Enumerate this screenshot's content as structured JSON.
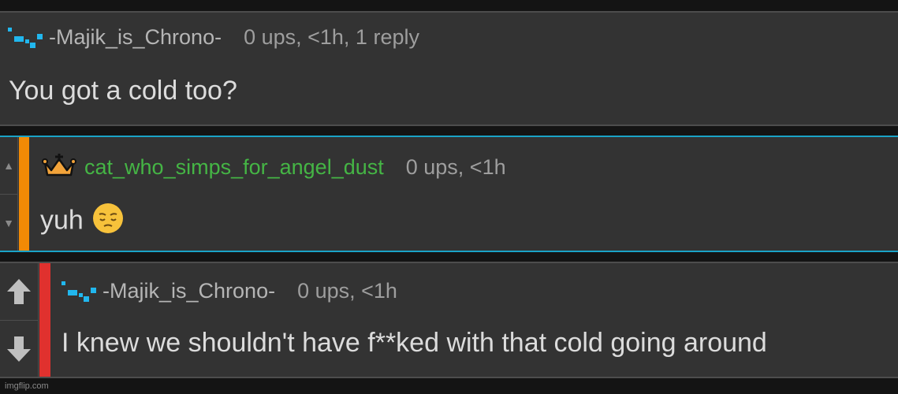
{
  "comments": [
    {
      "username": "-Majik_is_Chrono-",
      "meta": "0 ups, <1h, 1 reply",
      "text": "You got a cold too?"
    },
    {
      "username": "cat_who_simps_for_angel_dust",
      "meta": "0 ups, <1h",
      "text": "yuh",
      "username_color": "#45b545",
      "bar_color": "#f28a05"
    },
    {
      "username": "-Majik_is_Chrono-",
      "meta": "0 ups, <1h",
      "text": "I knew we shouldn't have f**ked with that cold going around",
      "bar_color": "#e0312e"
    }
  ],
  "icons": {
    "badge": "pixel-badge-icon",
    "crown": "crown-icon",
    "emoji": "pensive-face-emoji",
    "upvote": "arrow-up-icon",
    "downvote": "arrow-down-icon"
  },
  "colors": {
    "accent_blue": "#1aa3c7",
    "background": "#333333"
  },
  "watermark": "imgflip.com"
}
